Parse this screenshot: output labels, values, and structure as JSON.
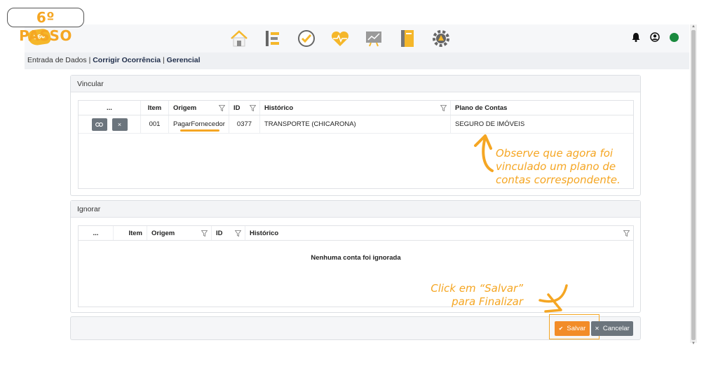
{
  "step_badge": "6º PASSO",
  "app": {
    "logo_text": "360",
    "breadcrumb": {
      "item1": "Entrada de Dados",
      "sep": " | ",
      "item2": "Corrigir Ocorrência",
      "item3": "Gerencial"
    }
  },
  "vincular": {
    "title": "Vincular",
    "columns": [
      "...",
      "Item",
      "Origem",
      "ID",
      "Histórico",
      "Plano de Contas"
    ],
    "rows": [
      {
        "link_icon": "link-icon",
        "remove_label": "×",
        "item": "001",
        "origem": "PagarFornecedor",
        "id": "0377",
        "historico": "TRANSPORTE (CHICARONA)",
        "plano": "SEGURO DE IMÓVEIS"
      }
    ]
  },
  "ignorar": {
    "title": "Ignorar",
    "columns": [
      "...",
      "Item",
      "Origem",
      "ID",
      "Histórico"
    ],
    "empty_message": "Nenhuma conta foi ignorada"
  },
  "notes": {
    "observe": [
      "Observe que agora foi",
      "vinculado um plano de",
      "contas correspondente."
    ],
    "click": [
      "Click em “Salvar”",
      "para Finalizar"
    ]
  },
  "actions": {
    "save_label": "Salvar",
    "cancel_label": "Cancelar"
  },
  "colors": {
    "accent": "#f5a623",
    "save_button": "#f28c28",
    "secondary_button": "#6c757d",
    "status_online": "#1a8a3e"
  },
  "icons": {
    "nav": [
      "home-icon",
      "hierarchy-icon",
      "check-circle-icon",
      "heart-pulse-icon",
      "chart-board-icon",
      "book-icon",
      "settings-triangle-icon"
    ],
    "right": [
      "bell-icon",
      "user-circle-icon",
      "status-dot-icon"
    ]
  }
}
